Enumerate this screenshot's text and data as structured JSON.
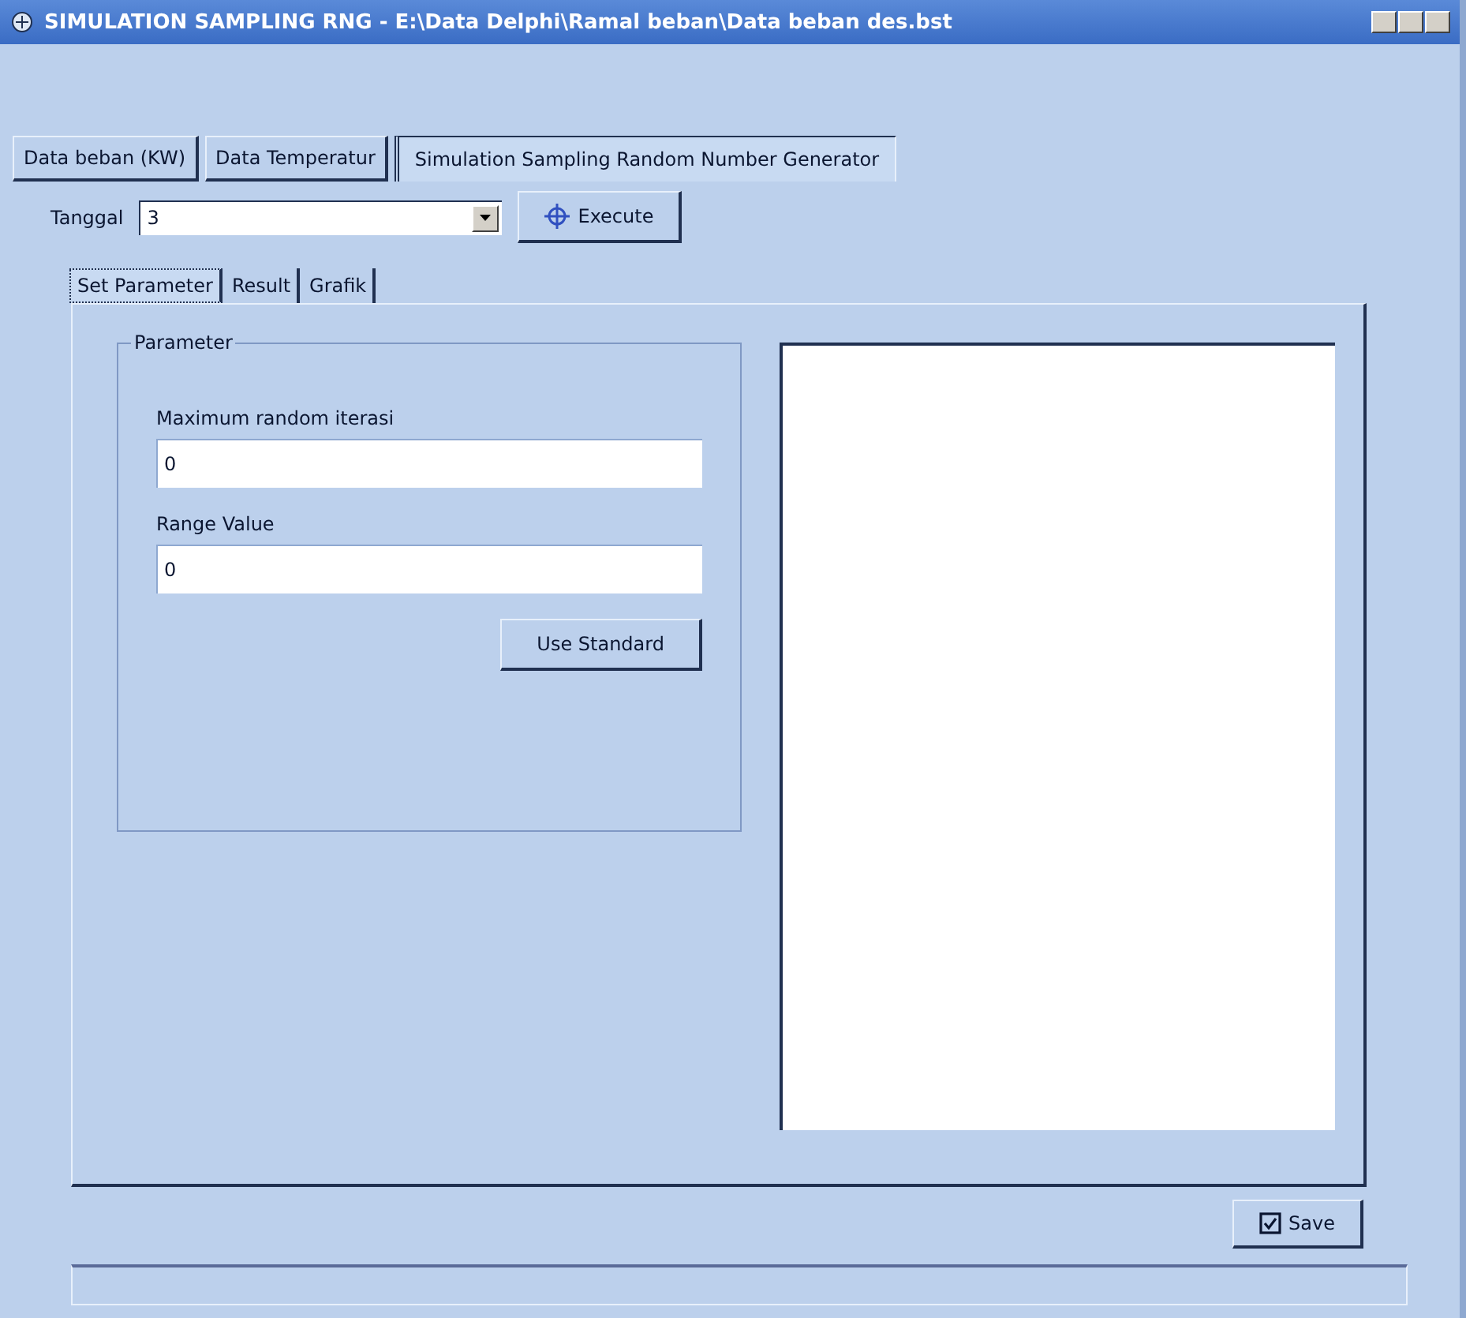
{
  "window": {
    "title": "SIMULATION SAMPLING RNG - E:\\Data Delphi\\Ramal beban\\Data beban des.bst"
  },
  "tabs": [
    {
      "label": "Data beban (KW)",
      "selected": false
    },
    {
      "label": "Data Temperatur",
      "selected": false
    },
    {
      "label": "Simulation Sampling Random Number Generator",
      "selected": true
    }
  ],
  "date": {
    "label": "Tanggal",
    "value": "3"
  },
  "execute_button": "Execute",
  "subtabs": [
    {
      "label": "Set Parameter",
      "selected": true
    },
    {
      "label": "Result",
      "selected": false
    },
    {
      "label": "Grafik",
      "selected": false
    }
  ],
  "parameter_group": {
    "title": "Parameter",
    "fields": [
      {
        "label": "Maximum random iterasi",
        "value": "0"
      },
      {
        "label": "Range Value",
        "value": "0"
      }
    ],
    "button": "Use Standard"
  },
  "save_button": "Save"
}
